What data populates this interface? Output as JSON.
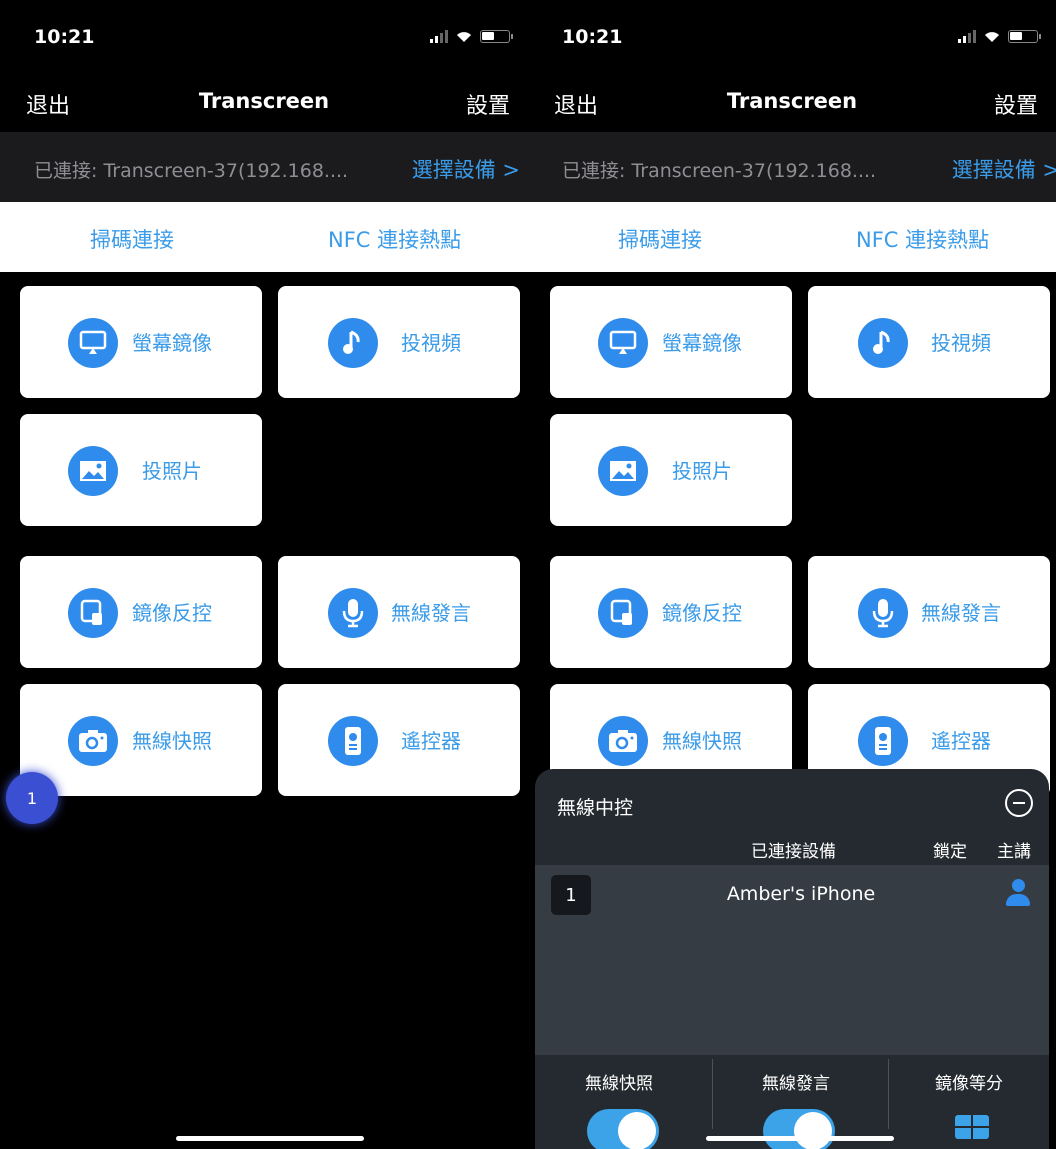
{
  "screens": [
    {
      "status": {
        "time": "10:21"
      },
      "nav": {
        "exit": "退出",
        "title": "Transcreen",
        "settings": "設置"
      },
      "connection": {
        "status": "已連接: Transcreen-37(192.168....",
        "select": "選擇設備 >"
      },
      "modes": {
        "scan": "掃碼連接",
        "nfc": "NFC 連接熱點"
      },
      "features": {
        "mirror": "螢幕鏡像",
        "video": "投視頻",
        "photo": "投照片",
        "reverse": "鏡像反控",
        "speak": "無線發言",
        "snapshot": "無線快照",
        "remote": "遙控器"
      },
      "floating_badge": "1"
    },
    {
      "status": {
        "time": "10:21"
      },
      "nav": {
        "exit": "退出",
        "title": "Transcreen",
        "settings": "設置"
      },
      "connection": {
        "status": "已連接: Transcreen-37(192.168....",
        "select": "選擇設備 >"
      },
      "modes": {
        "scan": "掃碼連接",
        "nfc": "NFC 連接熱點"
      },
      "features": {
        "mirror": "螢幕鏡像",
        "video": "投視頻",
        "photo": "投照片",
        "reverse": "鏡像反控",
        "speak": "無線發言",
        "snapshot": "無線快照",
        "remote": "遙控器"
      },
      "panel": {
        "title": "無線中控",
        "col_devices": "已連接設備",
        "col_lock": "鎖定",
        "col_host": "主講",
        "devices": [
          {
            "index": "1",
            "name": "Amber's iPhone"
          }
        ],
        "footer": {
          "snapshot": "無線快照",
          "speak": "無線發言",
          "split": "鏡像等分",
          "snapshot_on": true,
          "speak_on": true
        }
      }
    }
  ],
  "colors": {
    "accent": "#3a9be8",
    "icon_circle": "#2f8cec",
    "panel_bg": "#242a2f"
  }
}
